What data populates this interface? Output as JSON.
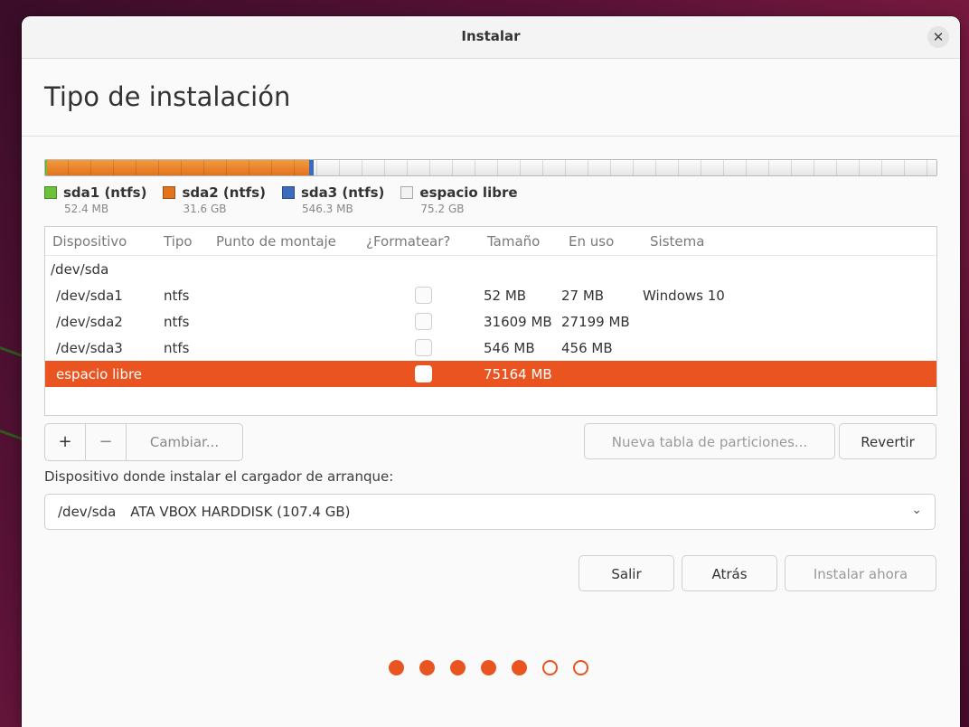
{
  "window": {
    "title": "Instalar"
  },
  "page": {
    "title": "Tipo de instalación"
  },
  "colors": {
    "accent": "#e95420",
    "sda1": "#6ac33a",
    "sda2": "#e2731f",
    "sda3": "#3b6bbb",
    "free": "#f2f2f2"
  },
  "partition_bar": {
    "segments": [
      {
        "name": "sda1",
        "size_mb": 52.4
      },
      {
        "name": "sda2",
        "size_mb": 31609
      },
      {
        "name": "sda3",
        "size_mb": 546.3
      },
      {
        "name": "espacio libre",
        "size_mb": 75164
      }
    ]
  },
  "legend": [
    {
      "label": "sda1 (ntfs)",
      "size": "52.4 MB",
      "color": "#6ac33a"
    },
    {
      "label": "sda2 (ntfs)",
      "size": "31.6 GB",
      "color": "#e2731f"
    },
    {
      "label": "sda3 (ntfs)",
      "size": "546.3 MB",
      "color": "#3b6bbb"
    },
    {
      "label": "espacio libre",
      "size": "75.2 GB",
      "color": "#f2f2f2"
    }
  ],
  "table": {
    "headers": [
      "Dispositivo",
      "Tipo",
      "Punto de montaje",
      "¿Formatear?",
      "Tamaño",
      "En uso",
      "Sistema"
    ],
    "rows": [
      {
        "device": "/dev/sda",
        "type": "",
        "mount": "",
        "format": null,
        "size": "",
        "used": "",
        "system": ""
      },
      {
        "device": "/dev/sda1",
        "type": "ntfs",
        "mount": "",
        "format": false,
        "size": "52 MB",
        "used": "27 MB",
        "system": "Windows 10"
      },
      {
        "device": "/dev/sda2",
        "type": "ntfs",
        "mount": "",
        "format": false,
        "size": "31609 MB",
        "used": "27199 MB",
        "system": ""
      },
      {
        "device": "/dev/sda3",
        "type": "ntfs",
        "mount": "",
        "format": false,
        "size": "546 MB",
        "used": "456 MB",
        "system": ""
      },
      {
        "device": "espacio libre",
        "type": "",
        "mount": "",
        "format": false,
        "size": "75164 MB",
        "used": "",
        "system": "",
        "selected": true
      }
    ]
  },
  "actions": {
    "add": "+",
    "remove": "−",
    "change": "Cambiar...",
    "new_table": "Nueva tabla de particiones...",
    "revert": "Revertir"
  },
  "bootloader": {
    "label": "Dispositivo donde instalar el cargador de arranque:",
    "device": "/dev/sda",
    "description": "ATA VBOX HARDDISK (107.4 GB)"
  },
  "nav": {
    "quit": "Salir",
    "back": "Atrás",
    "install": "Instalar ahora"
  },
  "progress": {
    "total_steps": 7,
    "completed_steps": 5
  }
}
